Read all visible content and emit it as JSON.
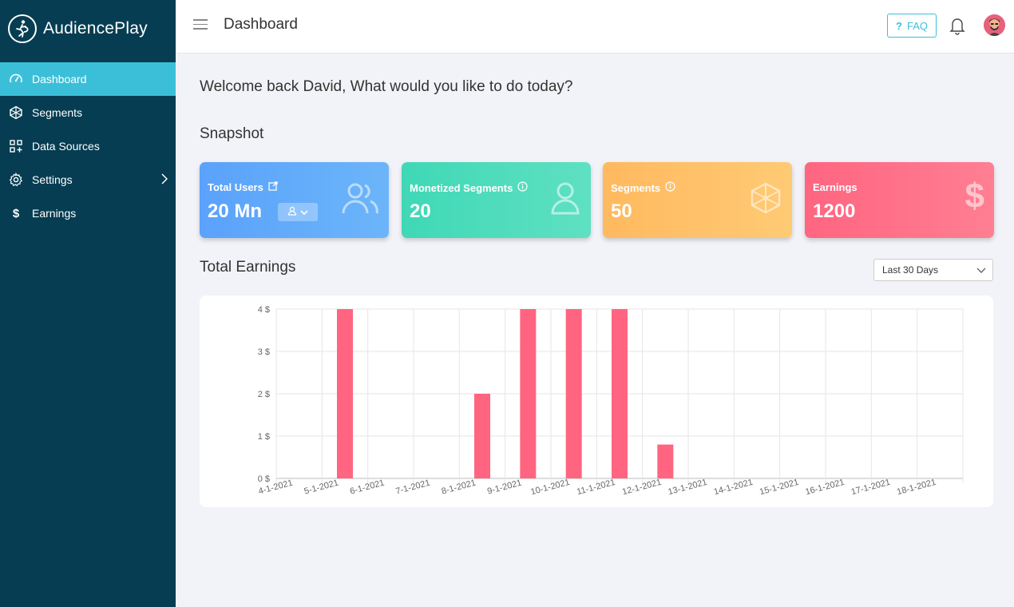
{
  "app": {
    "name": "AudiencePlay"
  },
  "sidebar": {
    "items": [
      {
        "label": "Dashboard",
        "icon": "speedometer-icon",
        "active": true
      },
      {
        "label": "Segments",
        "icon": "cube-network-icon"
      },
      {
        "label": "Data Sources",
        "icon": "grid-plus-icon"
      },
      {
        "label": "Settings",
        "icon": "gear-icon"
      },
      {
        "label": "Earnings",
        "icon": "dollar-icon"
      }
    ]
  },
  "header": {
    "title": "Dashboard",
    "faq_label": "FAQ",
    "faq_icon": "?"
  },
  "welcome": "Welcome back David, What would you like to do today?",
  "snapshot": {
    "title": "Snapshot",
    "cards": [
      {
        "label": "Total Users",
        "value": "20 Mn",
        "color": "#5aa2fb"
      },
      {
        "label": "Monetized Segments",
        "value": "20",
        "color": "#3fd8b6"
      },
      {
        "label": "Segments",
        "value": "50",
        "color": "#ffb95f"
      },
      {
        "label": "Earnings",
        "value": "1200",
        "color": "#ff6580"
      }
    ]
  },
  "earnings": {
    "title": "Total Earnings",
    "period": "Last 30 Days"
  },
  "chart_data": {
    "type": "bar",
    "categories": [
      "4-1-2021",
      "5-1-2021",
      "6-1-2021",
      "7-1-2021",
      "8-1-2021",
      "9-1-2021",
      "10-1-2021",
      "11-1-2021",
      "12-1-2021",
      "13-1-2021",
      "14-1-2021",
      "15-1-2021",
      "16-1-2021",
      "17-1-2021",
      "18-1-2021"
    ],
    "values": [
      0,
      4,
      0,
      0,
      2,
      4,
      4,
      4,
      0.8,
      0,
      0,
      0,
      0,
      0,
      0
    ],
    "ylim": [
      0,
      4
    ],
    "yticks": [
      "0 $",
      "1 $",
      "2 $",
      "3 $",
      "4 $"
    ],
    "bar_color": "#ff6580",
    "grid": true
  }
}
